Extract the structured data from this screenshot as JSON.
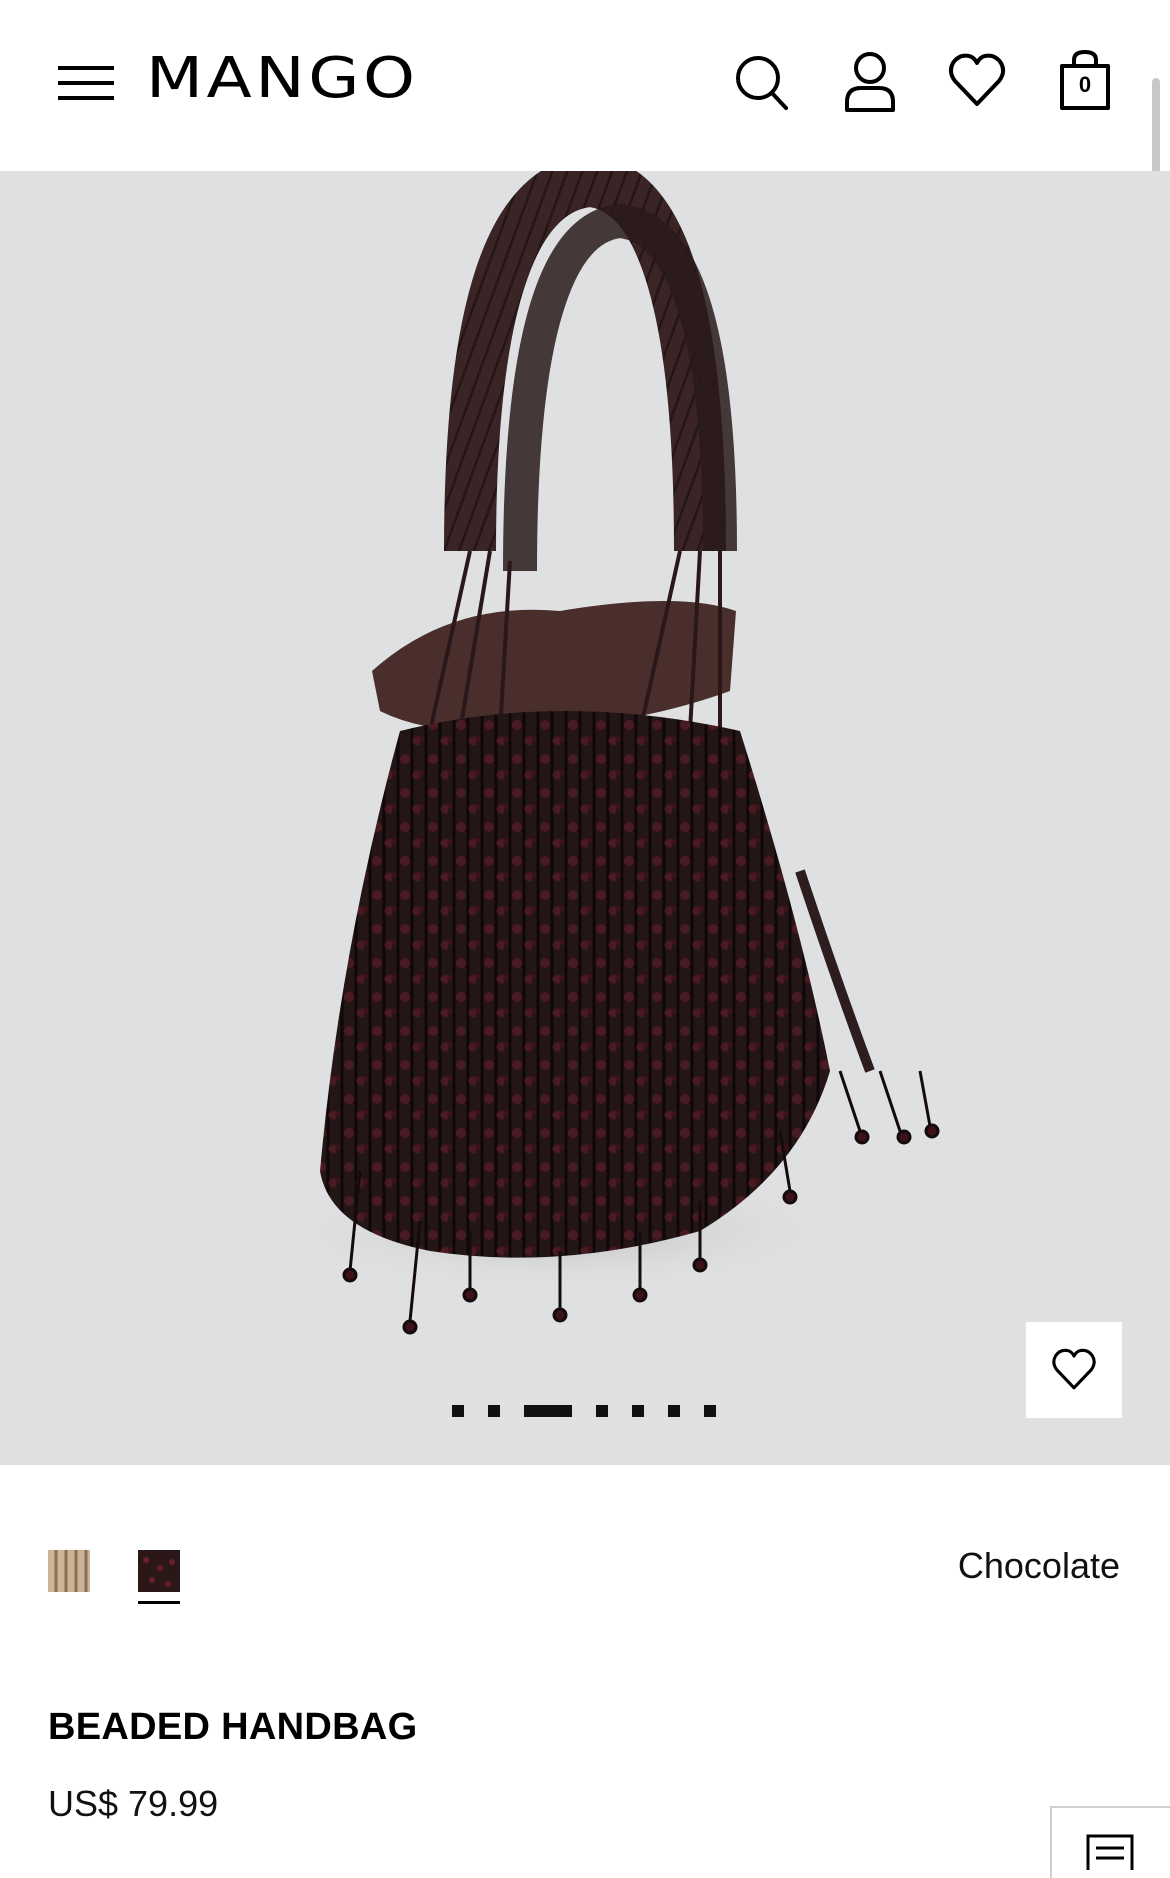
{
  "header": {
    "logo": "MANGO",
    "bag_count": "0"
  },
  "gallery": {
    "total_images": 7,
    "active_index": 2
  },
  "product": {
    "color_name": "Chocolate",
    "title": "BEADED HANDBAG",
    "price": "US$ 79.99",
    "swatches": [
      {
        "color": "#cbb596"
      },
      {
        "color": "#2b1618"
      }
    ],
    "selected_swatch": 1
  },
  "colors": {
    "background": "#ffffff",
    "hero_background": "#dfe0e1",
    "bag": "#2e1d1e",
    "bead": "#4a1a22",
    "lining": "#4a2e2c"
  }
}
